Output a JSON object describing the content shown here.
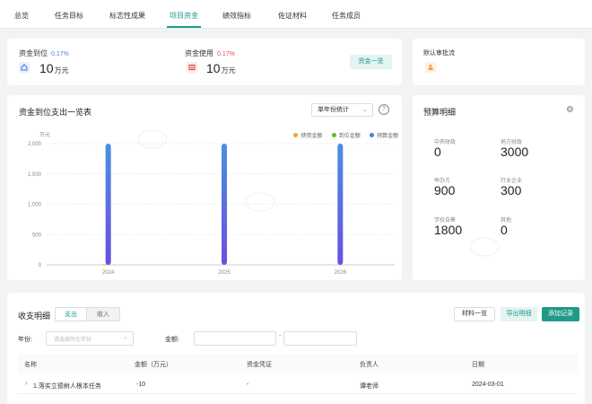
{
  "tabs": [
    "总览",
    "任务目标",
    "标志性成果",
    "项目资金",
    "绩效指标",
    "佐证材料",
    "任务成员"
  ],
  "funds": {
    "received": {
      "label": "资金到位",
      "pct": "0.17%",
      "value": "10",
      "unit": "万元"
    },
    "used": {
      "label": "资金使用",
      "pct": "0.17%",
      "value": "10",
      "unit": "万元"
    },
    "overview_button": "资金一览",
    "approval_label": "默认审批流"
  },
  "chart_panel": {
    "title": "资金到位支出一览表",
    "select_value": "单年份统计"
  },
  "chart_data": {
    "type": "bar",
    "categories": [
      "2024",
      "2025",
      "2026"
    ],
    "series": [
      {
        "name": "使用金额",
        "color": "#f5a623",
        "values": [
          10,
          0,
          0
        ]
      },
      {
        "name": "到位金额",
        "color": "#52c41a",
        "values": [
          10,
          0,
          0
        ]
      },
      {
        "name": "预算金额",
        "color": "#4a7fe0",
        "values": [
          2000,
          2000,
          2000
        ]
      }
    ],
    "ylabel": "万元",
    "ylim": [
      0,
      2000
    ],
    "yticks": [
      "0",
      "500",
      "1,000",
      "1,500",
      "2,000"
    ],
    "grid": true,
    "legend": "top-right"
  },
  "budget": {
    "title": "预算明细",
    "items": [
      {
        "label": "中央财政",
        "value": "0"
      },
      {
        "label": "地方财政",
        "value": "3000"
      },
      {
        "label": "举办方",
        "value": "900"
      },
      {
        "label": "行业企业",
        "value": "300"
      },
      {
        "label": "学校自筹",
        "value": "1800"
      },
      {
        "label": "其他",
        "value": "0"
      }
    ]
  },
  "ledger": {
    "title": "收支明细",
    "seg_expense": "支出",
    "seg_income": "收入",
    "btn_materials": "材料一览",
    "btn_export": "导出明细",
    "btn_add": "添加记录",
    "year_label": "年份:",
    "year_placeholder": "请选择所在年份",
    "amount_label": "金额:",
    "range_sep": "-",
    "columns": [
      "名称",
      "金额（万元）",
      "资金凭证",
      "负责人",
      "日期"
    ],
    "rows": [
      {
        "name": "1.落实立德树人根本任务",
        "amount": "-10",
        "voucher": "-",
        "owner": "谭老师",
        "date": "2024-03-01"
      }
    ]
  },
  "colors": {
    "accent": "#1f9a8a",
    "bar_top": "#4a90e2",
    "bar_bottom": "#6a4fe0"
  }
}
